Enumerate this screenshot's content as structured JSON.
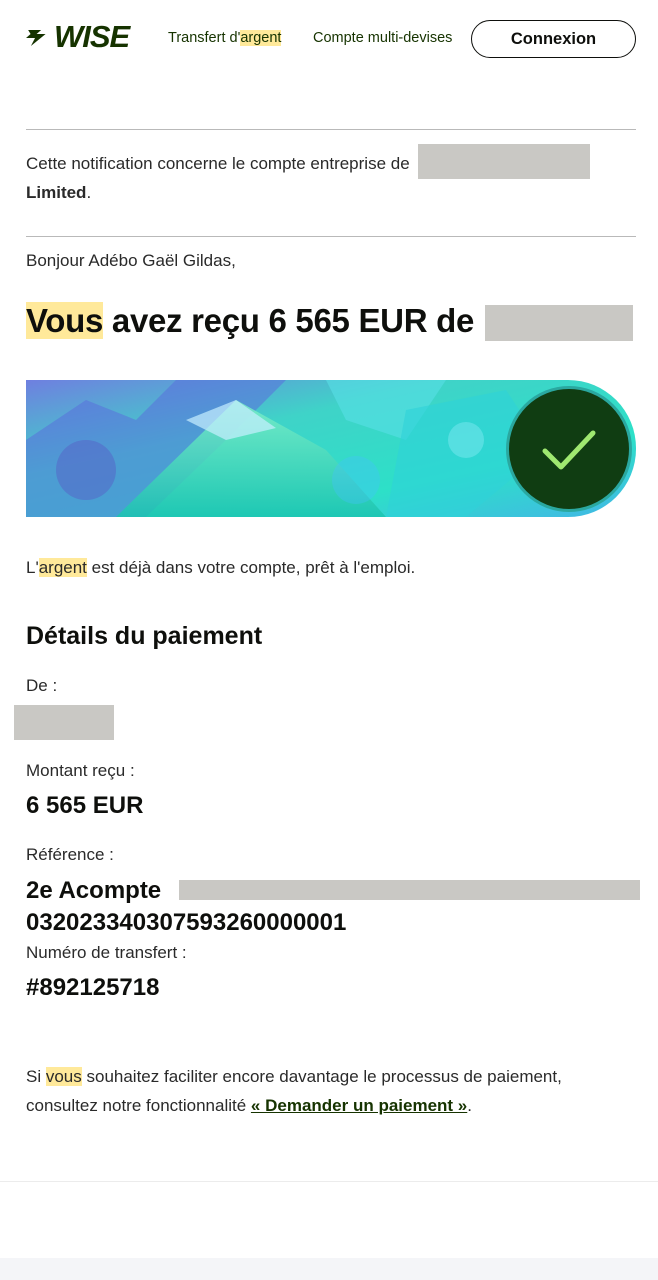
{
  "header": {
    "logo_text": "WISE",
    "nav": [
      {
        "prefix": "Transfert d'",
        "highlight": "argent"
      },
      {
        "label": "Compte multi-devises"
      }
    ],
    "connect_label": "Connexion"
  },
  "notification": {
    "text": "Cette notification concerne le compte entreprise de",
    "company_suffix": "Limited",
    "end": "."
  },
  "greeting": "Bonjour Adébo Gaël Gildas,",
  "headline": {
    "highlight": "Vous",
    "rest": " avez reçu 6 565 EUR de"
  },
  "ready": {
    "prefix": "L'",
    "highlight": "argent",
    "rest": " est déjà dans votre compte, prêt à l'emploi."
  },
  "details": {
    "title": "Détails du paiement",
    "from_label": "De :",
    "amount_label": "Montant reçu :",
    "amount_value": "6 565 EUR",
    "reference_label": "Référence :",
    "reference_line1": "2e Acompte",
    "reference_line2": "03202334030759326000000‌1",
    "transfer_label": "Numéro de transfert :",
    "transfer_value": "#892125718"
  },
  "footer": {
    "prefix": "Si ",
    "highlight": "vous",
    "middle": " souhaitez faciliter encore davantage le processus de paiement, consultez notre fonctionnalité ",
    "link": "« Demander un paiement »",
    "end": "."
  },
  "colors": {
    "brand_dark": "#163300",
    "check_bg": "#103d12",
    "check_mark": "#9fe870",
    "highlight": "#ffe99a"
  },
  "icons": [
    "wise-logo-icon",
    "checkmark-icon"
  ]
}
